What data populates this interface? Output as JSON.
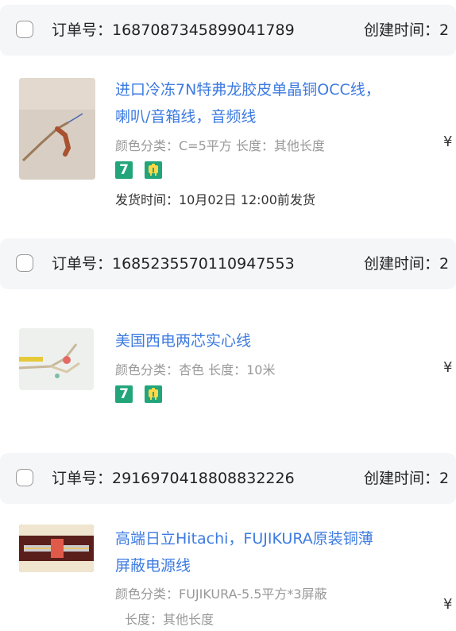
{
  "orders": [
    {
      "order_no_label": "订单号：1687087345899041789",
      "created_label": "创建时间：2",
      "product": {
        "title": "进口冷冻7N特弗龙胶皮单晶铜OCC线，喇叭/音箱线，音频线",
        "attrs": "颜色分类：C=5平方  长度：其他长度",
        "price_symbol": "¥",
        "ship_time": "发货时间：10月02日 12:00前发货"
      }
    },
    {
      "order_no_label": "订单号：1685235570110947553",
      "created_label": "创建时间：2",
      "product": {
        "title": "美国西电两芯实心线",
        "attrs": "颜色分类：杏色  长度：10米",
        "price_symbol": "¥"
      }
    },
    {
      "order_no_label": "订单号：2916970418808832226",
      "created_label": "创建时间：2",
      "product": {
        "title": "高端日立Hitachi，FUJIKURA原装铜薄屏蔽电源线",
        "attrs": "颜色分类：FUJIKURA-5.5平方*3屏蔽",
        "attrs2": "长度：其他长度",
        "price_symbol": "¥"
      }
    }
  ],
  "badge_seven_text": "7",
  "icons": [
    "seven-day-return-icon",
    "shipping-insurance-icon"
  ],
  "colors": {
    "link": "#3d7be0",
    "badge": "#22a57a",
    "header_bg": "#f5f6f8"
  }
}
